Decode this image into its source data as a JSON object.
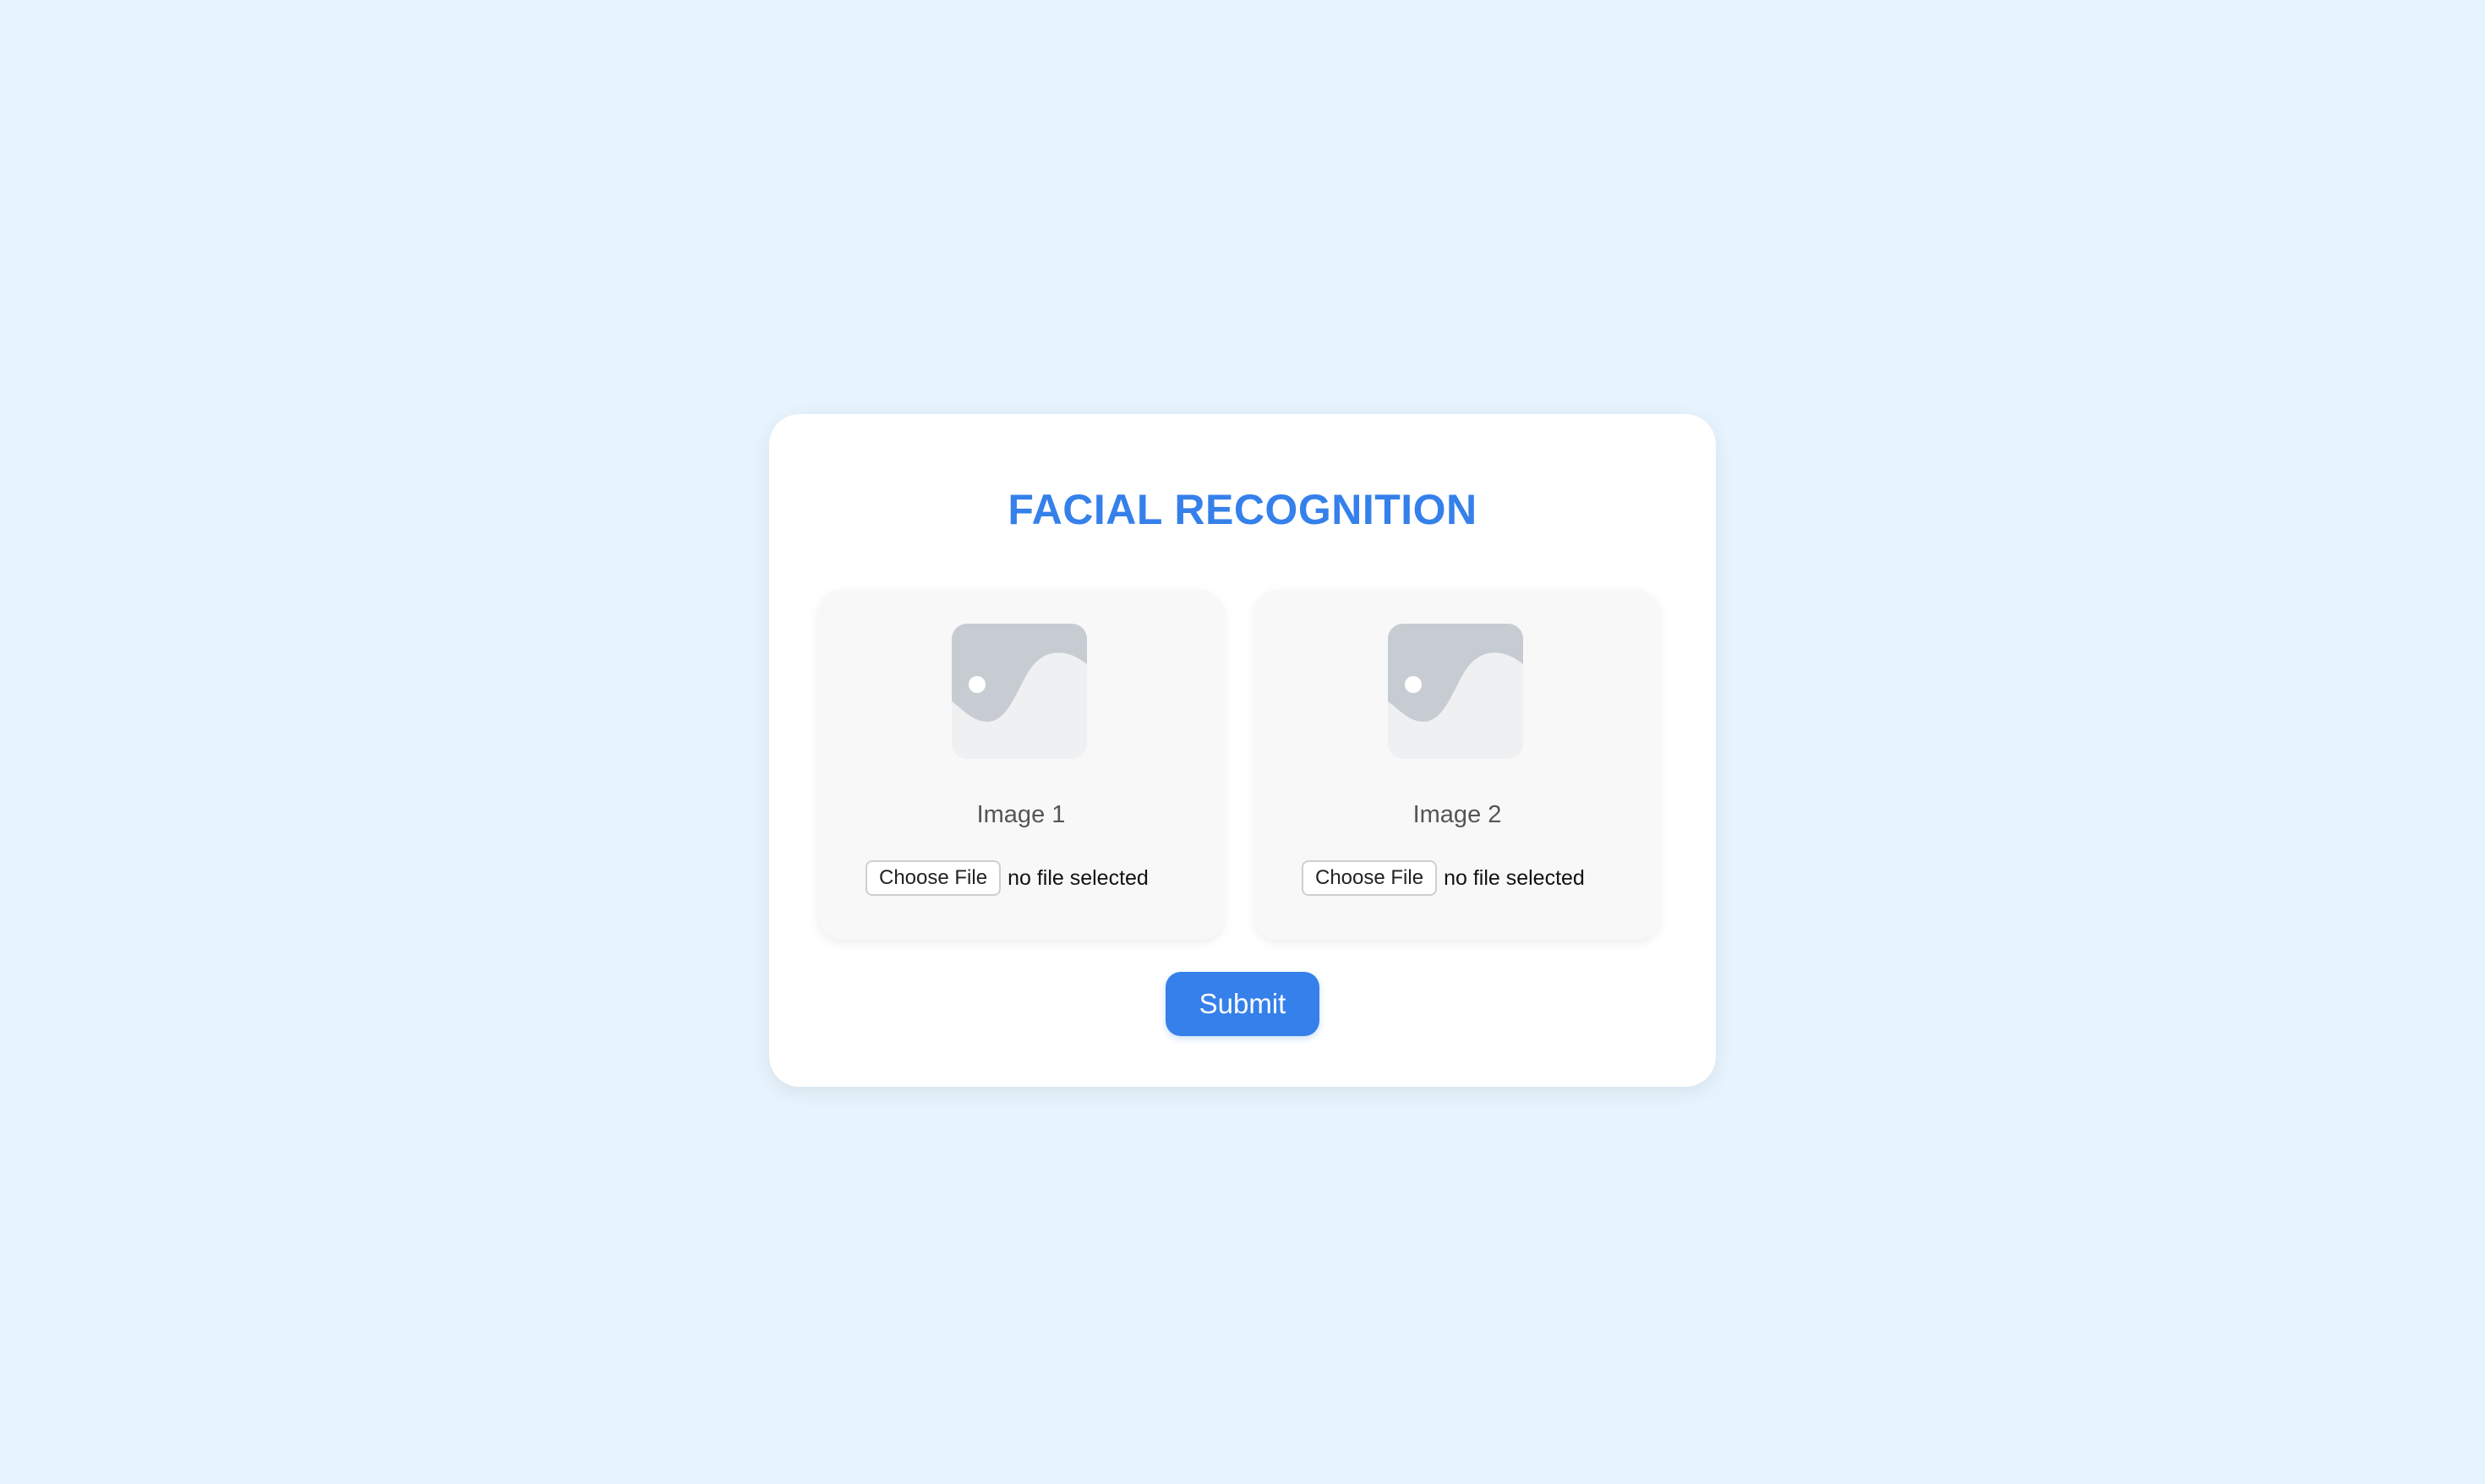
{
  "page": {
    "title": "FACIAL RECOGNITION"
  },
  "uploads": [
    {
      "label": "Image 1",
      "button_label": "Choose File",
      "status": "no file selected",
      "icon": "image-placeholder-icon"
    },
    {
      "label": "Image 2",
      "button_label": "Choose File",
      "status": "no file selected",
      "icon": "image-placeholder-icon"
    }
  ],
  "actions": {
    "submit_label": "Submit"
  },
  "colors": {
    "background": "#e8f4fd",
    "accent": "#3580ea",
    "panel": "#f8f8f8",
    "placeholder_bg": "#eef0f2",
    "placeholder_shape": "#c6ccd2"
  }
}
